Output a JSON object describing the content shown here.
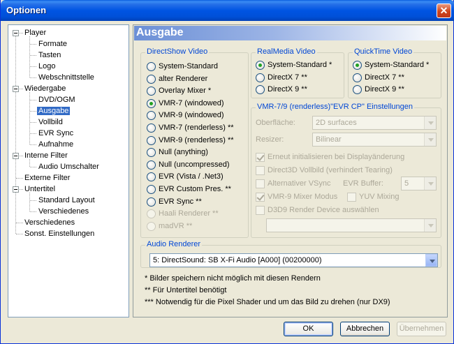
{
  "window": {
    "title": "Optionen",
    "close": "✕"
  },
  "tree": {
    "items": [
      {
        "label": "Player",
        "level": 0,
        "expander": true
      },
      {
        "label": "Formate",
        "level": 1
      },
      {
        "label": "Tasten",
        "level": 1
      },
      {
        "label": "Logo",
        "level": 1
      },
      {
        "label": "Webschnittstelle",
        "level": 1
      },
      {
        "label": "Wiedergabe",
        "level": 0,
        "expander": true
      },
      {
        "label": "DVD/OGM",
        "level": 1
      },
      {
        "label": "Ausgabe",
        "level": 1,
        "selected": true
      },
      {
        "label": "Vollbild",
        "level": 1
      },
      {
        "label": "EVR Sync",
        "level": 1
      },
      {
        "label": "Aufnahme",
        "level": 1
      },
      {
        "label": "Interne Filter",
        "level": 0,
        "expander": true
      },
      {
        "label": "Audio Umschalter",
        "level": 1
      },
      {
        "label": "Externe Filter",
        "level": 0
      },
      {
        "label": "Untertitel",
        "level": 0,
        "expander": true
      },
      {
        "label": "Standard Layout",
        "level": 1
      },
      {
        "label": "Verschiedenes",
        "level": 1
      },
      {
        "label": "Verschiedenes",
        "level": 0
      },
      {
        "label": "Sonst. Einstellungen",
        "level": 0
      }
    ]
  },
  "panel": {
    "title": "Ausgabe"
  },
  "directshow": {
    "label": "DirectShow Video",
    "options": [
      {
        "label": "System-Standard",
        "checked": false,
        "enabled": true
      },
      {
        "label": "alter Renderer",
        "checked": false,
        "enabled": true
      },
      {
        "label": "Overlay Mixer *",
        "checked": false,
        "enabled": true
      },
      {
        "label": "VMR-7 (windowed)",
        "checked": true,
        "enabled": true
      },
      {
        "label": "VMR-9 (windowed)",
        "checked": false,
        "enabled": true
      },
      {
        "label": "VMR-7 (renderless) **",
        "checked": false,
        "enabled": true
      },
      {
        "label": "VMR-9 (renderless) **",
        "checked": false,
        "enabled": true
      },
      {
        "label": "Null (anything)",
        "checked": false,
        "enabled": true
      },
      {
        "label": "Null (uncompressed)",
        "checked": false,
        "enabled": true
      },
      {
        "label": "EVR (Vista / .Net3)",
        "checked": false,
        "enabled": true
      },
      {
        "label": "EVR Custom Pres. **",
        "checked": false,
        "enabled": true
      },
      {
        "label": "EVR Sync **",
        "checked": false,
        "enabled": true
      },
      {
        "label": "Haali Renderer **",
        "checked": false,
        "enabled": false
      },
      {
        "label": "madVR **",
        "checked": false,
        "enabled": false
      }
    ]
  },
  "realmedia": {
    "label": "RealMedia Video",
    "options": [
      {
        "label": "System-Standard *",
        "checked": true
      },
      {
        "label": "DirectX 7 **",
        "checked": false
      },
      {
        "label": "DirectX 9 **",
        "checked": false
      }
    ]
  },
  "quicktime": {
    "label": "QuickTime Video",
    "options": [
      {
        "label": "System-Standard *",
        "checked": true
      },
      {
        "label": "DirectX 7 **",
        "checked": false
      },
      {
        "label": "DirectX 9 **",
        "checked": false
      }
    ]
  },
  "vmr": {
    "label": "VMR-7/9 (renderless)\"EVR CP\" Einstellungen",
    "surface_label": "Oberfläche:",
    "surface_value": "2D surfaces",
    "resizer_label": "Resizer:",
    "resizer_value": "Bilinear",
    "reinit": "Erneut initialisieren bei Displayänderung",
    "d3d_fullscreen": "Direct3D Vollbild (verhindert Tearing)",
    "alt_vsync": "Alternativer VSync",
    "evr_buffer_label": "EVR Buffer:",
    "evr_buffer_value": "5",
    "vmr9_mixer": "VMR-9 Mixer Modus",
    "yuv_mixing": "YUV Mixing",
    "d3d9_device": "D3D9 Render Device auswählen",
    "device_value": ""
  },
  "audio": {
    "label": "Audio Renderer",
    "value": "5: DirectSound: SB X-Fi Audio [A000] (00200000)"
  },
  "notes": [
    "* Bilder speichern nicht möglich mit diesen Rendern",
    "** Für Untertitel benötigt",
    "*** Notwendig für die Pixel Shader und um das Bild zu drehen (nur DX9)"
  ],
  "buttons": {
    "ok": "OK",
    "cancel": "Abbrechen",
    "apply": "Übernehmen"
  }
}
